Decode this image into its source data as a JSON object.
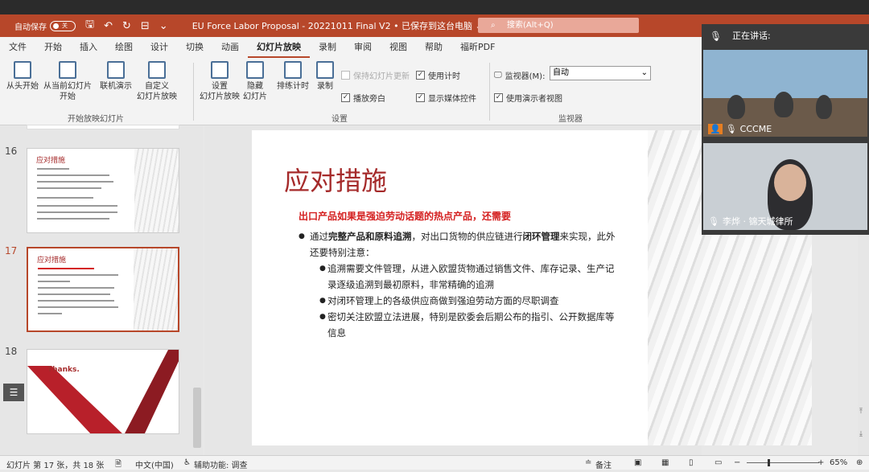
{
  "titlebar": {
    "autosave_label": "自动保存",
    "autosave_state": "关",
    "doc_title": "EU Force Labor Proposal - 20221011 Final V2 • 已保存到这台电脑 ⌄",
    "search_placeholder": "搜索(Alt+Q)"
  },
  "ribbon_tabs": [
    "文件",
    "开始",
    "插入",
    "绘图",
    "设计",
    "切换",
    "动画",
    "幻灯片放映",
    "录制",
    "审阅",
    "视图",
    "帮助",
    "福昕PDF"
  ],
  "ribbon": {
    "from_start": "从头开始",
    "from_current_1": "从当前幻灯片",
    "from_current_2": "开始",
    "online": "联机演示",
    "custom_1": "自定义",
    "custom_2": "幻灯片放映",
    "group_start": "开始放映幻灯片",
    "setup_1": "设置",
    "setup_2": "幻灯片放映",
    "hide_1": "隐藏",
    "hide_2": "幻灯片",
    "rehearse": "排练计时",
    "record": "录制",
    "keep_updated": "保持幻灯片更新",
    "play_narration": "播放旁白",
    "use_timings": "使用计时",
    "show_media": "显示媒体控件",
    "group_setup": "设置",
    "monitor_label": "监视器(M):",
    "monitor_value": "自动",
    "presenter_view": "使用演示者视图",
    "group_monitor": "监视器"
  },
  "thumbnails": [
    {
      "num": "16",
      "title": "应对措施"
    },
    {
      "num": "17",
      "title": "应对措施"
    },
    {
      "num": "18",
      "title": "Thanks."
    }
  ],
  "slide": {
    "title": "应对措施",
    "subtitle": "出口产品如果是强迫劳动话题的热点产品，还需要",
    "bullet1_a": "通过",
    "bullet1_b": "完整产品和原料追溯",
    "bullet1_c": "，对出口货物的供应链进行",
    "bullet1_d": "闭环管理",
    "bullet1_e": "来实现，此外还要特别注意：",
    "sub1": "追溯需要文件管理，从进入欧盟货物通过销售文件、库存记录、生产记录逐级追溯到最初原料，非常精确的追溯",
    "sub2": "对闭环管理上的各级供应商做到强迫劳动方面的尽职调查",
    "sub3": "密切关注欧盟立法进展，特别是欧委会后期公布的指引、公开数据库等信息"
  },
  "video": {
    "header": "正在讲话:",
    "tile1_label": "CCCME",
    "tile2_label": "李烨 · 锦天城律所"
  },
  "status": {
    "slide_count": "幻灯片 第 17 张，共 18 张",
    "language": "中文(中国)",
    "accessibility": "辅助功能: 调查",
    "notes": "备注",
    "zoom": "65%"
  },
  "colors": {
    "accent": "#b7472a",
    "title_red": "#a52a2a",
    "subtitle_red": "#d41f1f"
  }
}
